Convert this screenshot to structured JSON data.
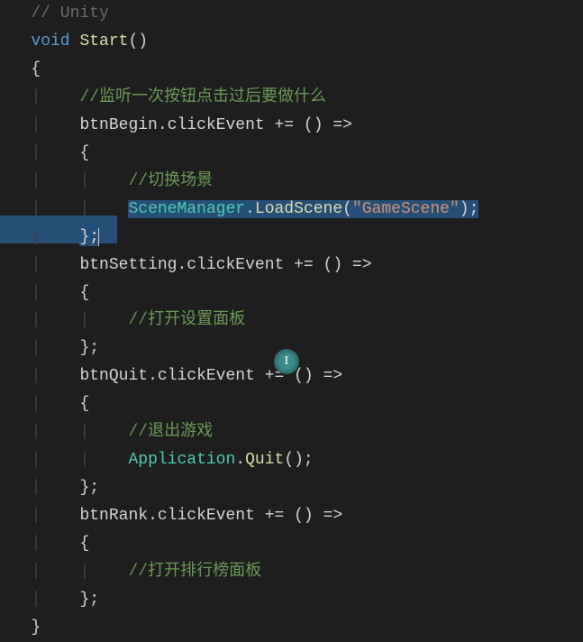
{
  "lines": {
    "l0": {
      "t1": "// Unity",
      "t2": " "
    },
    "l1": {
      "k1": "void",
      "m1": "Start",
      "p1": "()"
    },
    "l2": {
      "p1": "{"
    },
    "l3": {
      "c1": "//监听一次按钮点击过后要做什么"
    },
    "l4": {
      "id1": "btnBegin",
      "p1": ".",
      "id2": "clickEvent",
      "p2": " += () =>"
    },
    "l5": {
      "p1": "{"
    },
    "l6": {
      "c1": "//切换场景"
    },
    "l7": {
      "cls1": "SceneManager",
      "p1": ".",
      "m1": "LoadScene",
      "p2": "(",
      "s1": "\"GameScene\"",
      "p3": ");"
    },
    "l8": {
      "p1": "};"
    },
    "l9": {
      "id1": "btnSetting",
      "p1": ".",
      "id2": "clickEvent",
      "p2": " += () =>"
    },
    "l10": {
      "p1": "{"
    },
    "l11": {
      "c1": "//打开设置面板"
    },
    "l12": {
      "p1": "};"
    },
    "l13": {
      "id1": "btnQuit",
      "p1": ".",
      "id2": "clickEvent",
      "p2": " += () =>"
    },
    "l14": {
      "p1": "{"
    },
    "l15": {
      "c1": "//退出游戏"
    },
    "l16": {
      "cls1": "Application",
      "p1": ".",
      "m1": "Quit",
      "p2": "();"
    },
    "l17": {
      "p1": "};"
    },
    "l18": {
      "id1": "btnRank",
      "p1": ".",
      "id2": "clickEvent",
      "p2": " += () =>"
    },
    "l19": {
      "p1": "{"
    },
    "l20": {
      "c1": "//打开排行榜面板"
    },
    "l21": {
      "p1": "};"
    },
    "l22": {
      "p1": "}"
    }
  }
}
